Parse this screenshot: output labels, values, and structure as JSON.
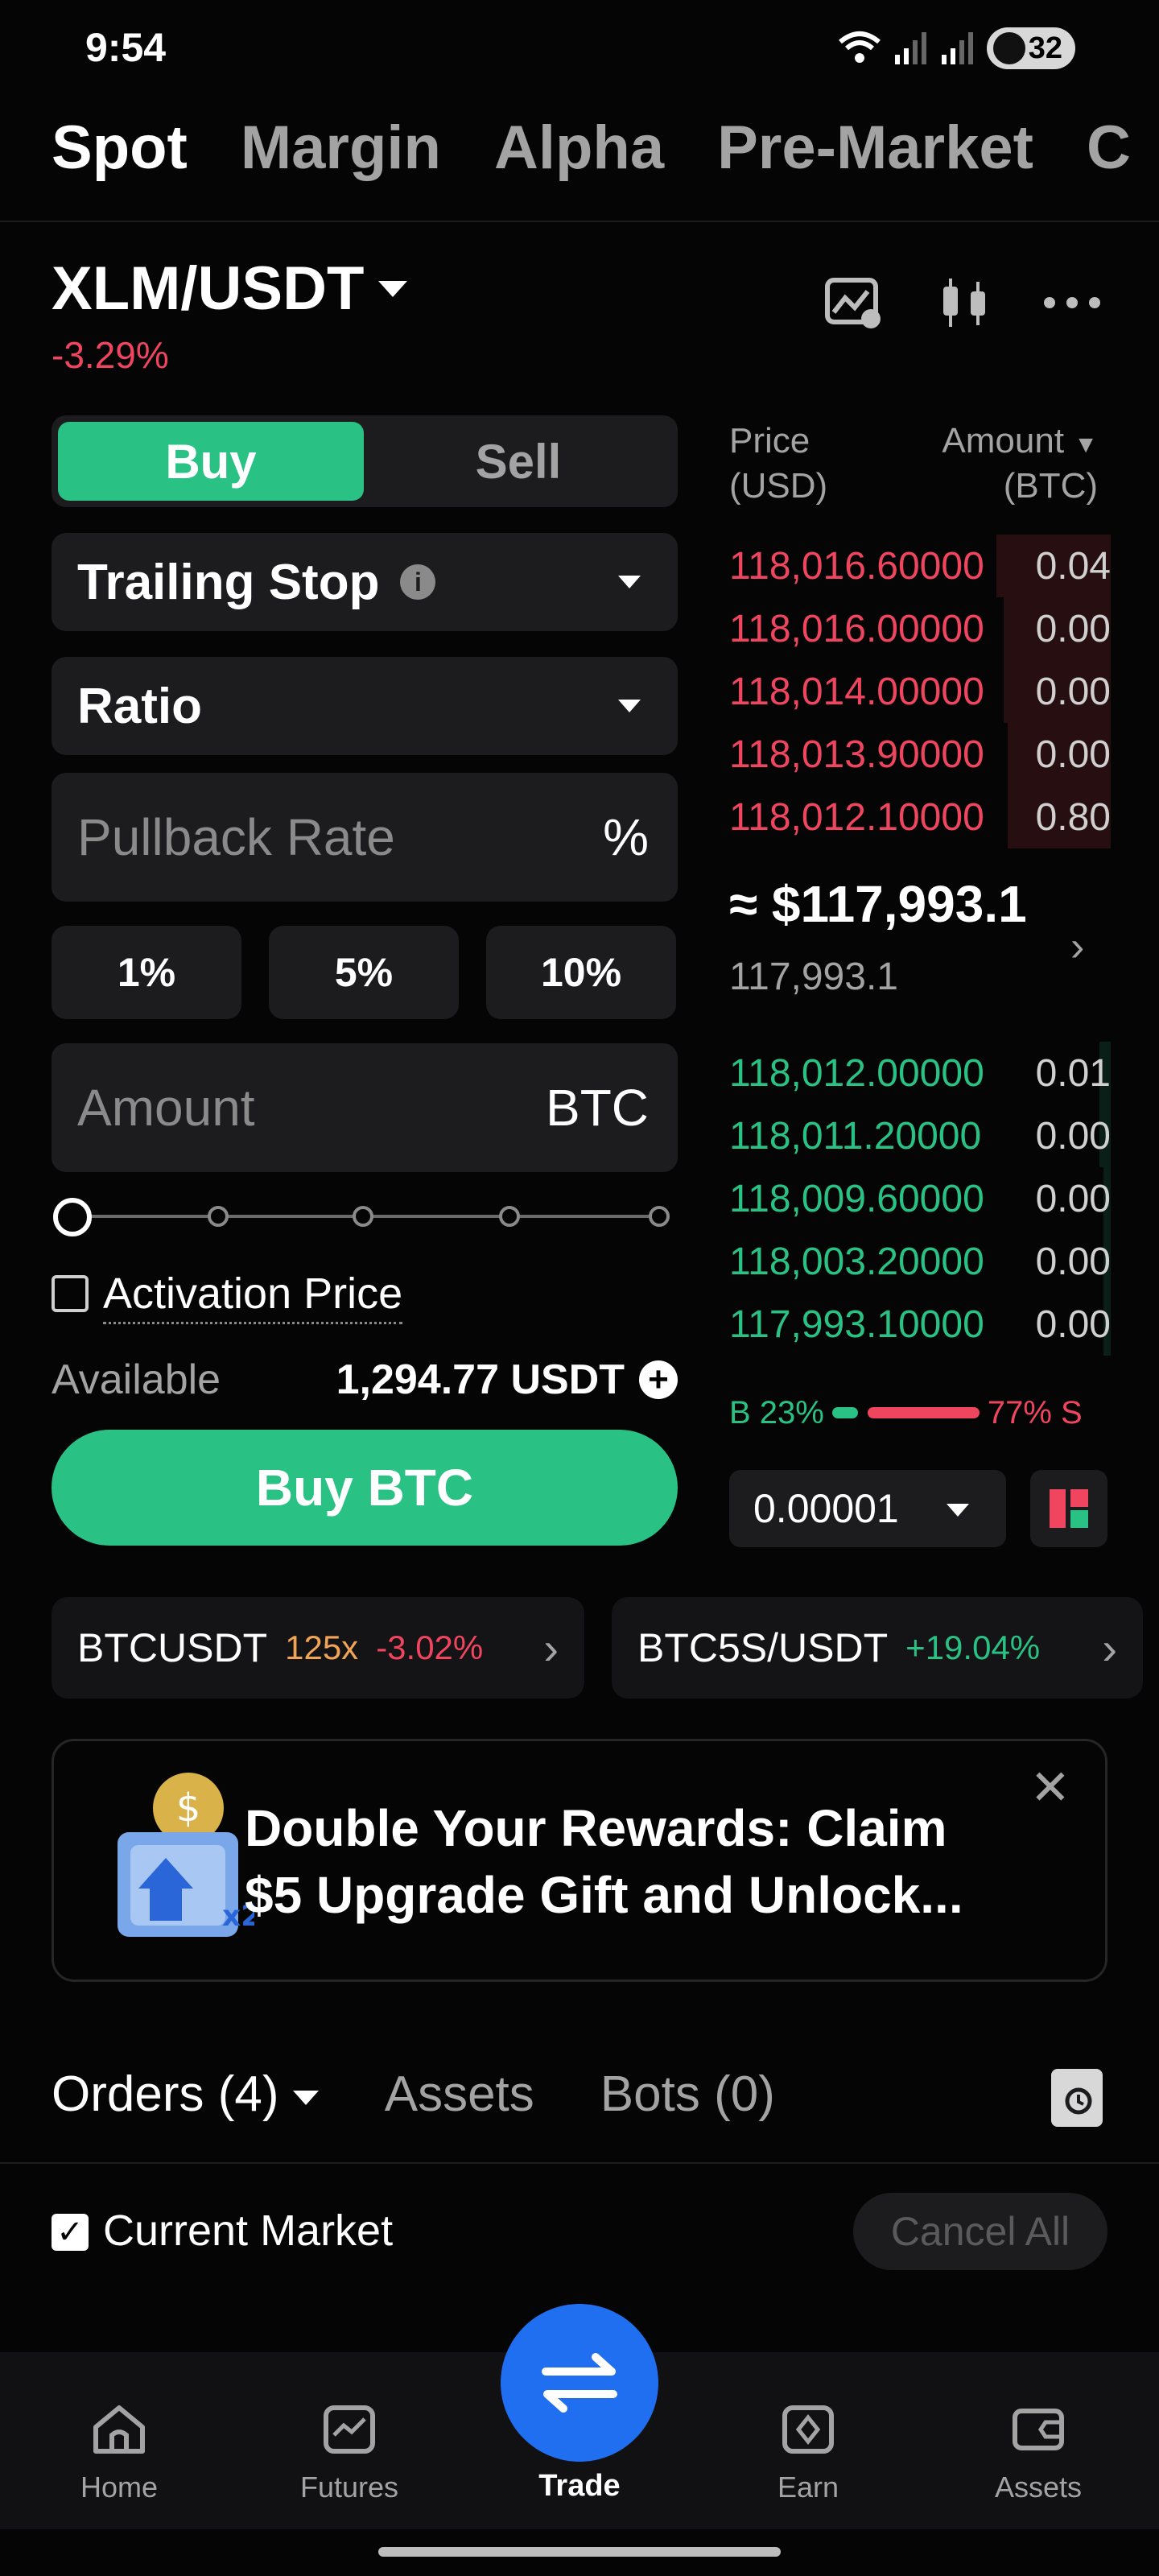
{
  "status": {
    "time": "9:54",
    "battery": "32"
  },
  "top_tabs": [
    "Spot",
    "Margin",
    "Alpha",
    "Pre-Market",
    "C"
  ],
  "pair": {
    "name": "XLM/USDT",
    "change": "-3.29%"
  },
  "trade": {
    "buy": "Buy",
    "sell": "Sell",
    "order_type": "Trailing Stop",
    "mode": "Ratio",
    "pullback_placeholder": "Pullback Rate",
    "pullback_unit": "%",
    "pct_options": [
      "1%",
      "5%",
      "10%"
    ],
    "amount_placeholder": "Amount",
    "amount_unit": "BTC",
    "activation_label": "Activation Price",
    "available_label": "Available",
    "available_value": "1,294.77 USDT",
    "submit": "Buy BTC"
  },
  "orderbook": {
    "price_header": [
      "Price",
      "(USD)"
    ],
    "amount_header": [
      "Amount",
      "(BTC)"
    ],
    "asks": [
      {
        "price": "118,016.60000",
        "amount": "0.04",
        "depth": 0.3
      },
      {
        "price": "118,016.00000",
        "amount": "0.00",
        "depth": 0.28
      },
      {
        "price": "118,014.00000",
        "amount": "0.00",
        "depth": 0.28
      },
      {
        "price": "118,013.90000",
        "amount": "0.00",
        "depth": 0.27
      },
      {
        "price": "118,012.10000",
        "amount": "0.80",
        "depth": 0.27
      }
    ],
    "mid_price": "≈ $117,993.1",
    "mid_sub": "117,993.1",
    "bids": [
      {
        "price": "118,012.00000",
        "amount": "0.01",
        "depth": 0.03
      },
      {
        "price": "118,011.20000",
        "amount": "0.00",
        "depth": 0.03
      },
      {
        "price": "118,009.60000",
        "amount": "0.00",
        "depth": 0.02
      },
      {
        "price": "118,003.20000",
        "amount": "0.00",
        "depth": 0.02
      },
      {
        "price": "117,993.10000",
        "amount": "0.00",
        "depth": 0.02
      }
    ],
    "buy_ratio": "B 23%",
    "sell_ratio": "77% S",
    "buy_ratio_value": 0.23,
    "tick_size": "0.00001"
  },
  "tickers": [
    {
      "name": "BTCUSDT",
      "leverage": "125x",
      "change": "-3.02%"
    },
    {
      "name": "BTC5S/USDT",
      "change": "+19.04%"
    }
  ],
  "banner": {
    "text": "Double Your Rewards: Claim $5 Upgrade Gift and  Unlock..."
  },
  "orders": {
    "tabs": [
      "Orders (4)",
      "Assets",
      "Bots (0)"
    ],
    "current_market": "Current Market",
    "cancel_all": "Cancel All"
  },
  "nav": [
    "Home",
    "Futures",
    "Trade",
    "Earn",
    "Assets"
  ],
  "colors": {
    "green": "#29c284",
    "red": "#f0455f",
    "blue": "#1f6ff0"
  }
}
